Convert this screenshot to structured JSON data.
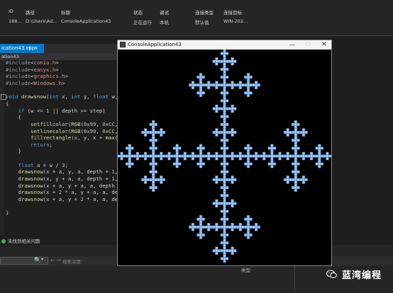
{
  "process_table": {
    "headers": [
      {
        "key": "id",
        "label": "ID"
      },
      {
        "key": "path",
        "label": "路径"
      },
      {
        "key": "title",
        "label": "标题"
      },
      {
        "key": "state",
        "label": "状态"
      },
      {
        "key": "debug",
        "label": "调试"
      },
      {
        "key": "conn_type",
        "label": "连接类型"
      },
      {
        "key": "conn_target",
        "label": "连接目标"
      }
    ],
    "row": {
      "id": "188...",
      "path": "D:\\Users\\Ad...",
      "title": "ConsoleApplication43",
      "state": "正在运行",
      "debug": "本机",
      "conn_type": "默认值",
      "conn_target": "WIN-202..."
    }
  },
  "editor": {
    "active_tab": "ication43.cpp",
    "tab_pin": "⊣",
    "tab_close": "×",
    "file_label": "ation43",
    "code_lines": [
      "#include<conio.h>",
      "#include<easyx.h>",
      "#include<graphics.h>",
      "#include<Windows.h>",
      "",
      "void drawsnow(int x, int y, float w,",
      "{",
      "    if (w <= 1 || depth >= step)",
      "    {",
      "        setfillcolor(RGB(0x99, 0xCC,",
      "        setlinecolor(RGB(0x99, 0xCC,",
      "        fillrectangle(x, y, x + max(",
      "        return;",
      "    }",
      "",
      "    float a = w / 3;",
      "    drawsnow(x + a, y, a, depth + 1,",
      "    drawsnow(x, y + a, a, depth + 1,",
      "    drawsnow(x + a, y + a, a, depth",
      "    drawsnow(x + 2 * a, y + a, a, de",
      "    drawsnow(x + a, y + 2 * a, a, de",
      "",
      "}"
    ]
  },
  "status": {
    "text": "未找到相关问题"
  },
  "bottom": {
    "search_icon": "🔍",
    "search_dropdown": "▾",
    "nav_left": "←",
    "nav_right": "→",
    "search_condition": "搜索深度:",
    "type_header": "类型"
  },
  "console": {
    "title": "ConsoleApplication43",
    "minimize": "—",
    "maximize": "☐",
    "close": "✕",
    "fractal_color": "#99CCFF",
    "fractal_depth": 4,
    "background": "#000000"
  },
  "watermark": {
    "text": "蓝湾编程"
  }
}
